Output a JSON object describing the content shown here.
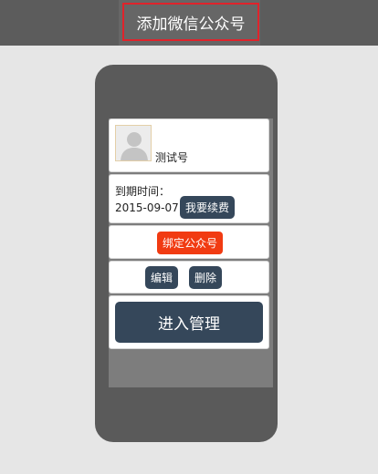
{
  "header": {
    "title": "添加微信公众号"
  },
  "account": {
    "name": "测试号",
    "avatar_icon": "default-user-avatar-icon"
  },
  "expiry": {
    "label": "到期时间：",
    "date": "2015-09-07",
    "renew_label": "我要续费"
  },
  "bind": {
    "label": "绑定公众号"
  },
  "actions": {
    "edit_label": "编辑",
    "delete_label": "删除"
  },
  "manage": {
    "label": "进入管理"
  },
  "colors": {
    "accent_dark": "#35475a",
    "accent_red": "#f13b12",
    "highlight_border": "#e0232b"
  }
}
